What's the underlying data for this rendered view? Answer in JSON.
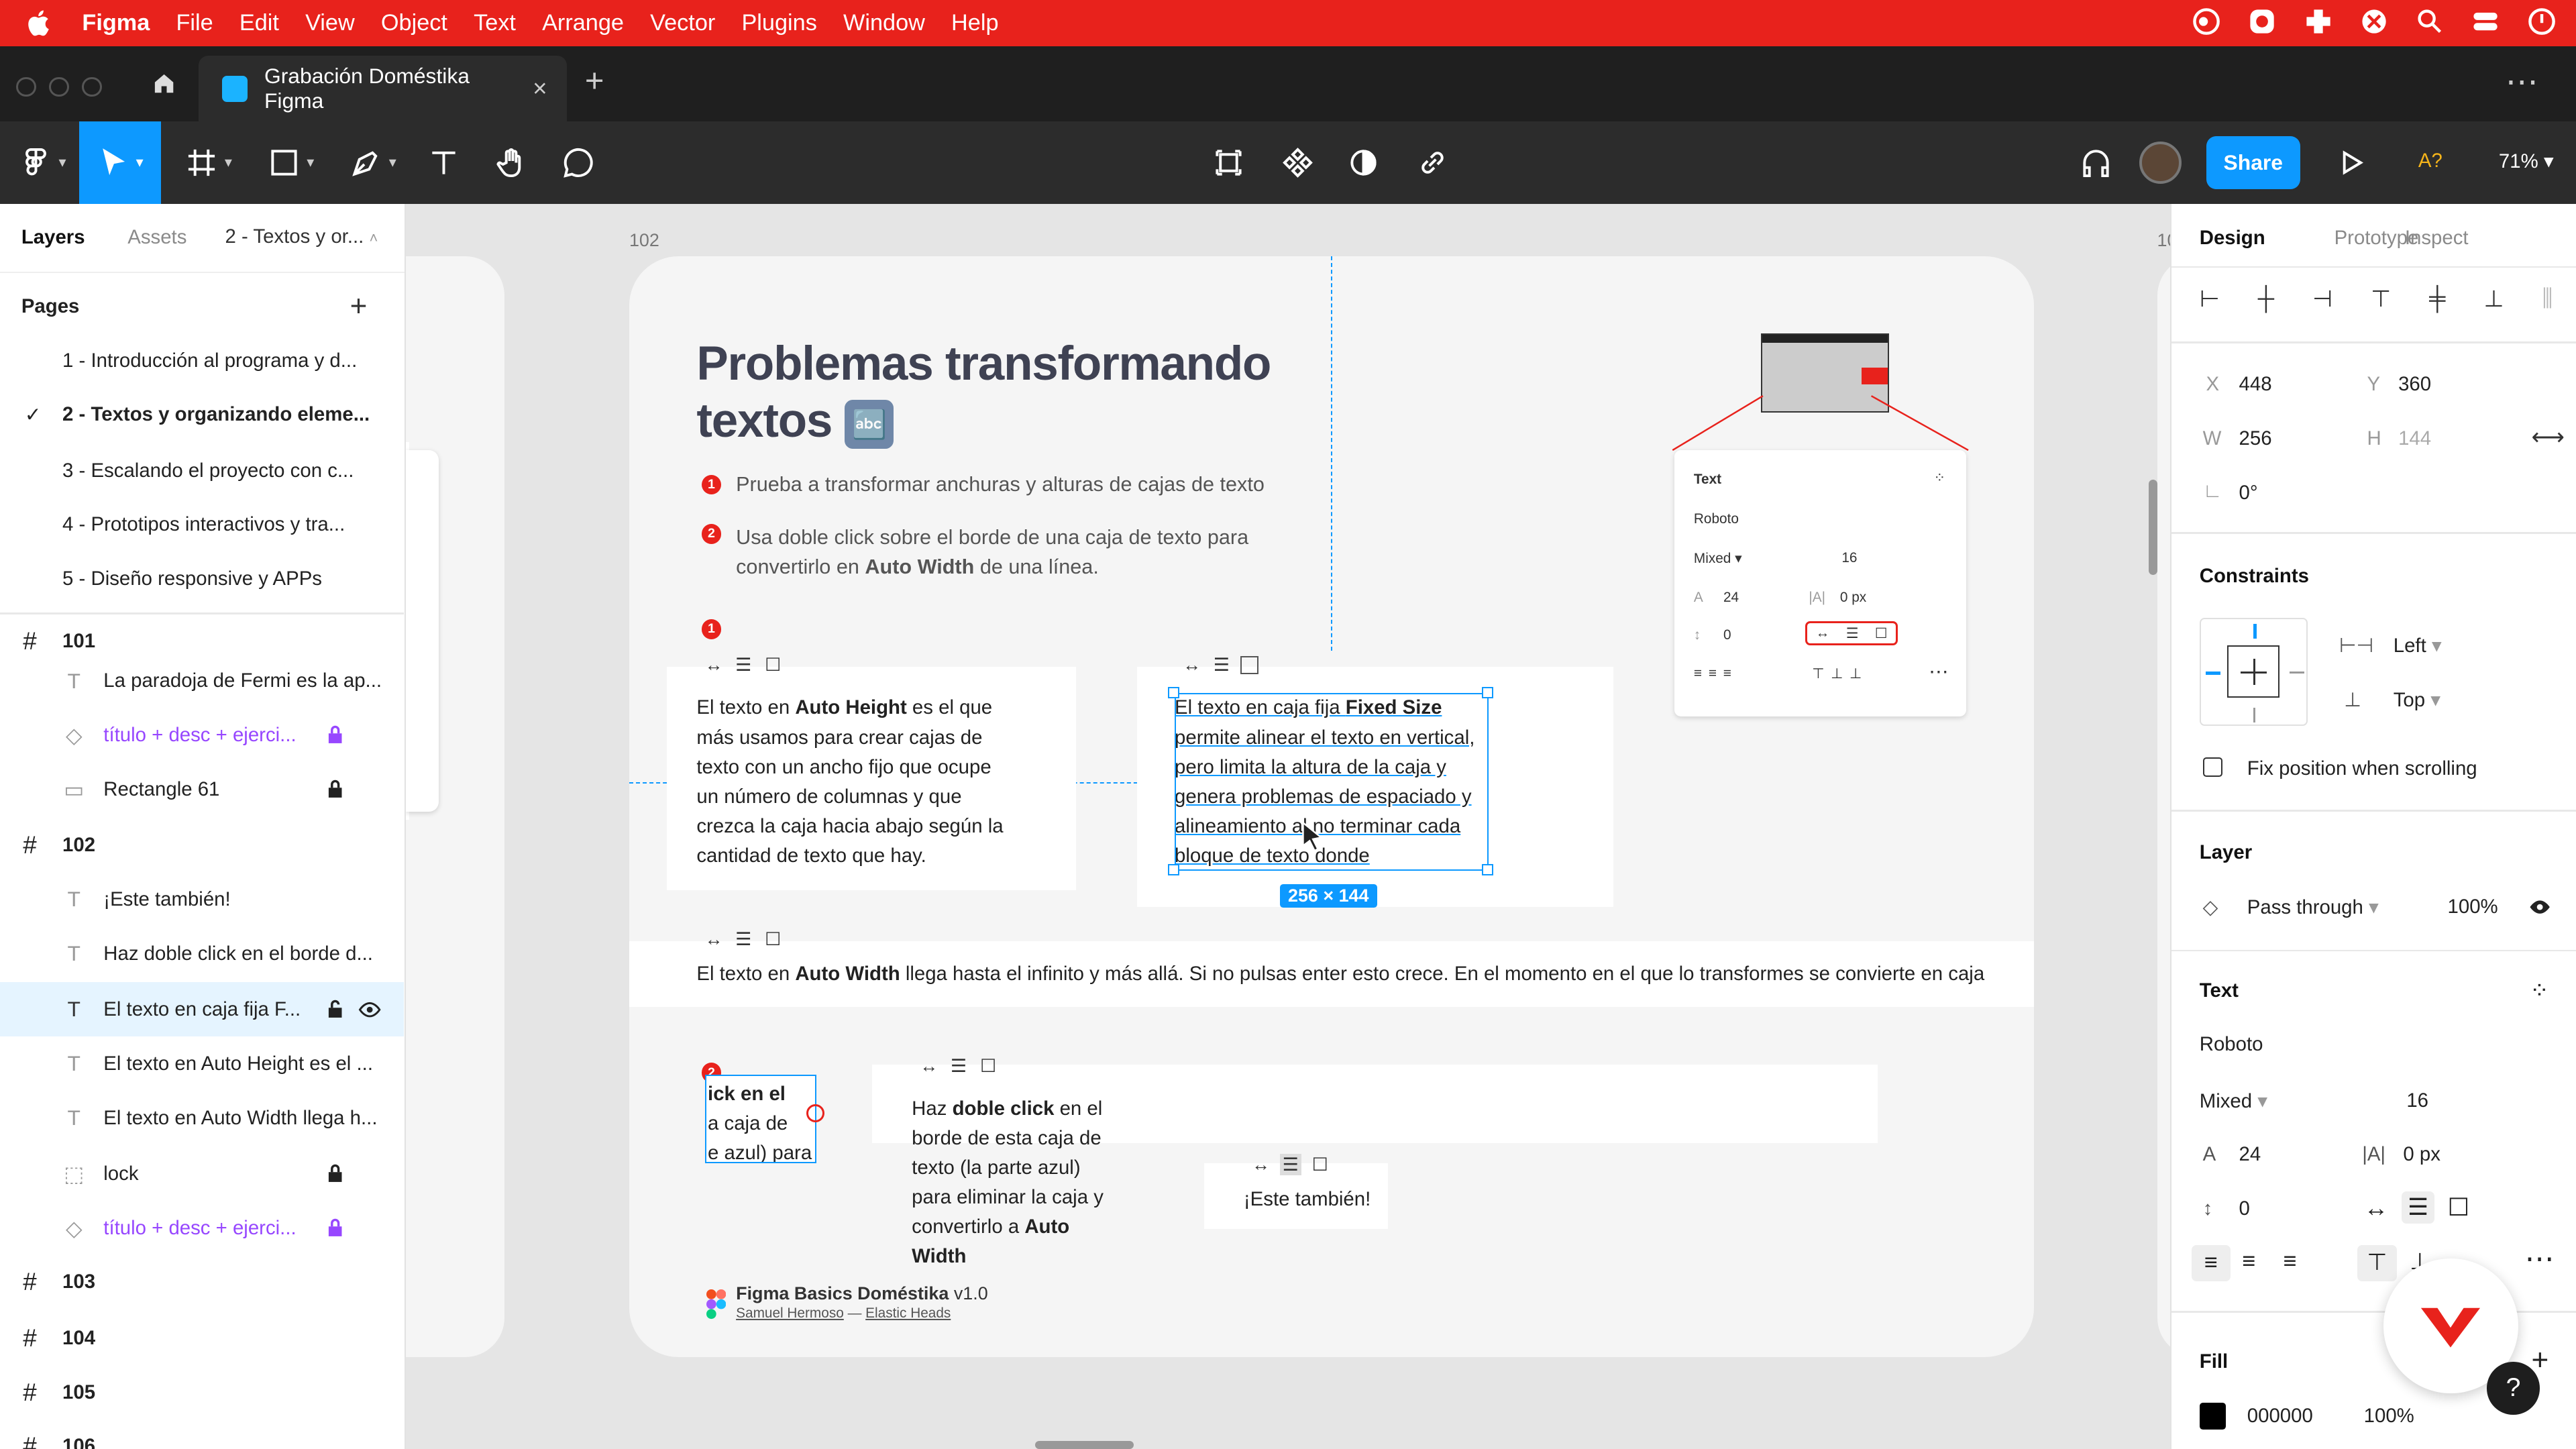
{
  "menubar": {
    "app": "Figma",
    "items": [
      "File",
      "Edit",
      "View",
      "Object",
      "Text",
      "Arrange",
      "Vector",
      "Plugins",
      "Window",
      "Help"
    ]
  },
  "tabs": {
    "active_title": "Grabación Doméstika Figma",
    "close": "×",
    "new": "+",
    "more": "⋯"
  },
  "toolbar": {
    "share": "Share",
    "ax": "A?",
    "zoom": "71%"
  },
  "left": {
    "tab_layers": "Layers",
    "tab_assets": "Assets",
    "page_selector": "2 - Textos y or...",
    "pages_title": "Pages",
    "add": "+",
    "pages": [
      "1 - Introducción al programa y d...",
      "2 - Textos y organizando eleme...",
      "3 - Escalando el proyecto con c...",
      "4 - Prototipos interactivos y tra...",
      "5 - Diseño responsive y APPs"
    ],
    "frame101": "101",
    "layers101": [
      "La paradoja de Fermi es la ap...",
      "título + desc + ejerci...",
      "Rectangle 61"
    ],
    "frame102": "102",
    "layers102": [
      "¡Este también!",
      "Haz doble click en el borde d...",
      "El texto en caja fija F...",
      "El texto en Auto Height es el ...",
      "El texto en Auto Width llega h...",
      "lock",
      "título + desc + ejerci..."
    ],
    "frames_more": [
      "103",
      "104",
      "105",
      "106"
    ]
  },
  "canvas": {
    "frame_label": "102",
    "frame_label_right": "10",
    "title_line1": "Problemas transformando",
    "title_line2": "textos",
    "title_emoji": "🔤",
    "step1": "Prueba a transformar anchuras y alturas de cajas de texto",
    "step2_a": "Usa doble click sobre el borde de una caja de texto para",
    "step2_b": "convertirlo en ",
    "step2_bold": "Auto Width",
    "step2_c": " de una línea.",
    "badge1": "1",
    "badge2": "2",
    "auto_height": {
      "pre": "El texto en ",
      "bold": "Auto Height",
      "post": " es el que más usamos para crear cajas de texto con un ancho fijo que ocupe un número de columnas y que crezca la caja hacia abajo según la cantidad de texto que hay."
    },
    "fixed": {
      "pre": "El texto en caja fija ",
      "bold": "Fixed Size",
      "post": " permite alinear el texto en vertical, pero limita la altura de la caja y genera problemas de espaciado y alineamiento al no terminar cada bloque de texto donde corresponde."
    },
    "size_badge": "256 × 144",
    "auto_width": {
      "pre": "El texto en ",
      "bold": "Auto Width",
      "post": " llega hasta el infinito y más allá. Si no pulsas enter esto crece. En el momento en el que lo transformes se convierte en caja"
    },
    "clipped_lines": [
      "ick en el",
      "a caja de",
      "e azul) para"
    ],
    "dbl": {
      "pre": "Haz ",
      "bold": "doble click",
      "mid": " en el borde de esta caja de texto (la parte azul) para eliminar la caja y convertirlo a ",
      "bold2": "Auto Width"
    },
    "also": "¡Este también!",
    "footer_title": "Figma Basics Doméstika",
    "footer_version": " v1.0",
    "footer_author": "Samuel Hermoso",
    "footer_sep": " — ",
    "footer_studio": "Elastic Heads",
    "mini_panel": {
      "title": "Text",
      "font": "Roboto",
      "weight": "Mixed",
      "size": "16",
      "lh": "24",
      "ls": "0 px",
      "ps": "0"
    }
  },
  "right": {
    "tab_design": "Design",
    "tab_prototype": "Prototype",
    "tab_inspect": "Inspect",
    "x_label": "X",
    "x": "448",
    "y_label": "Y",
    "y": "360",
    "w_label": "W",
    "w": "256",
    "h_label": "H",
    "h": "144",
    "rot": "0°",
    "constraints_title": "Constraints",
    "c_h": "Left",
    "c_v": "Top",
    "fix_scroll": "Fix position when scrolling",
    "layer_title": "Layer",
    "blend": "Pass through",
    "opacity": "100%",
    "text_title": "Text",
    "font": "Roboto",
    "weight": "Mixed",
    "size": "16",
    "lh": "24",
    "ls": "0 px",
    "ps": "0",
    "fill_title": "Fill",
    "fill_hex": "000000",
    "fill_op": "100%",
    "help": "?"
  },
  "colors": {
    "menubar": "#e8221c",
    "accent": "#0d99ff",
    "purple": "#9747ff"
  }
}
